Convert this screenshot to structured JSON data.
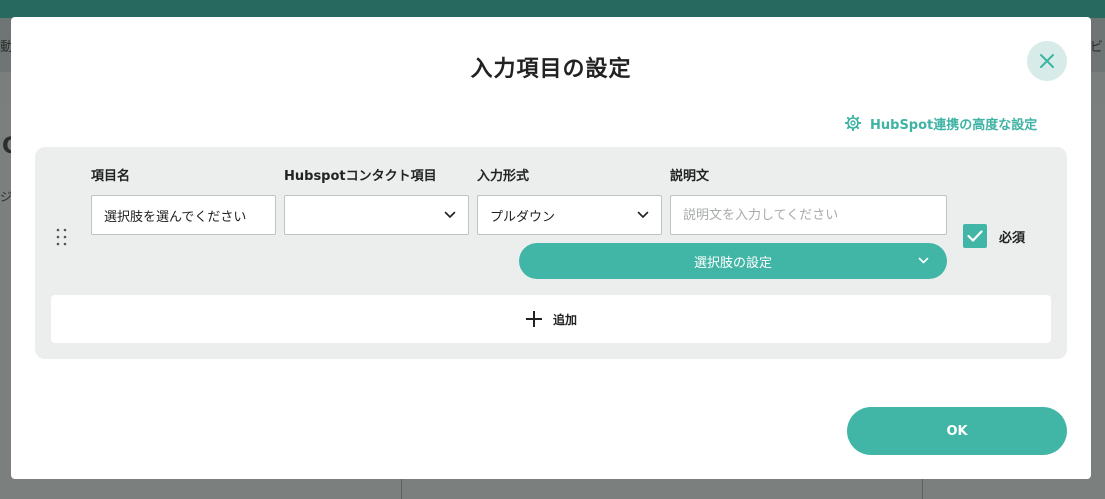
{
  "background": {
    "nav_left_fragment": "動",
    "nav_right_fragment": "ービ",
    "content_fragment_1": "C",
    "content_fragment_2": "ジ"
  },
  "modal": {
    "title": "入力項目の設定",
    "close_icon": "close-icon",
    "advanced_link": "HubSpot連携の高度な設定",
    "columns": {
      "item_name": "項目名",
      "hubspot_contact": "Hubspotコンタクト項目",
      "input_type": "入力形式",
      "description": "説明文"
    },
    "row": {
      "item_name_value": "選択肢を選んでください",
      "hubspot_contact_value": "",
      "input_type_value": "プルダウン",
      "description_value": "",
      "description_placeholder": "説明文を入力してください",
      "choice_settings_label": "選択肢の設定",
      "required_label": "必須",
      "required_checked": true
    },
    "add_label": "追加",
    "ok_label": "OK"
  },
  "colors": {
    "accent": "#42b6a6",
    "accent_light": "#d7ebe8",
    "panel_bg": "#eceeee",
    "topbar": "#27695f"
  }
}
